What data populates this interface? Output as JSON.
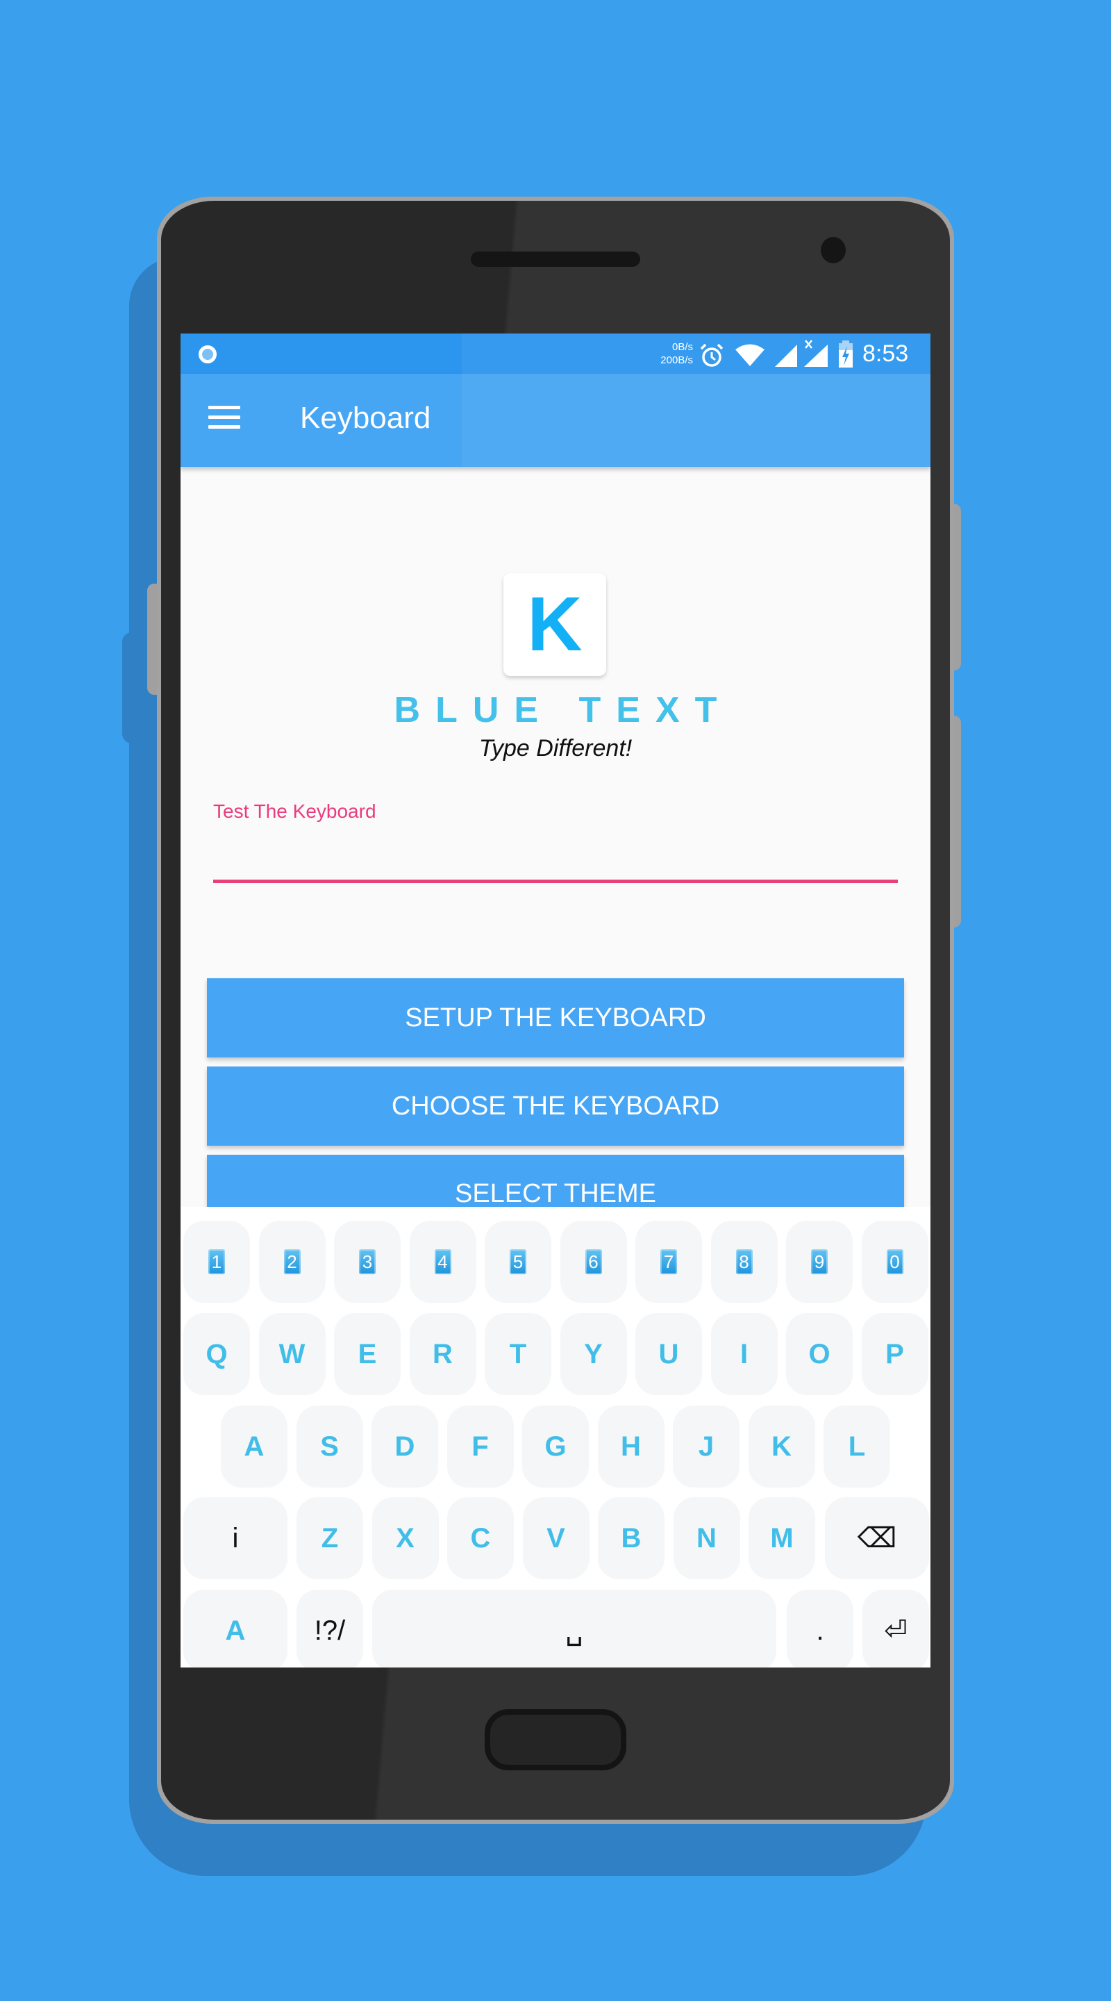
{
  "status_bar": {
    "net_down": "0B/s",
    "net_up": "200B/s",
    "icons": [
      "notification-ring-icon",
      "alarm-icon",
      "wifi-icon",
      "signal-icon",
      "signal-no-data-icon",
      "battery-charging-icon"
    ],
    "time": "8:53"
  },
  "app_bar": {
    "menu_icon": "hamburger-menu-icon",
    "title": "Keyboard"
  },
  "colors": {
    "app_bar": "#46a6f3",
    "status_bar": "#2c96ee",
    "brand_blue": "#43c1ea",
    "accent_pink": "#ea4079",
    "background": "#3a9fed"
  },
  "hero": {
    "logo_letter": "K",
    "brand_name": "BLUE TEXT",
    "tagline": "Type Different!"
  },
  "test_field": {
    "label": "Test The Keyboard",
    "value": "",
    "placeholder": ""
  },
  "buttons": {
    "setup": "SETUP THE KEYBOARD",
    "choose": "CHOOSE THE KEYBOARD",
    "theme": "SELECT THEME"
  },
  "keyboard": {
    "number_row": [
      "1",
      "2",
      "3",
      "4",
      "5",
      "6",
      "7",
      "8",
      "9",
      "0"
    ],
    "row1": [
      "Q",
      "W",
      "E",
      "R",
      "T",
      "Y",
      "U",
      "I",
      "O",
      "P"
    ],
    "row2": [
      "A",
      "S",
      "D",
      "F",
      "G",
      "H",
      "J",
      "K",
      "L"
    ],
    "row3": [
      "Z",
      "X",
      "C",
      "V",
      "B",
      "N",
      "M"
    ],
    "info_key": "i",
    "backspace": "⌫",
    "shift_key": "A",
    "symbols_key": "!?/",
    "space_key": "␣",
    "period_key": ".",
    "enter_key": "⏎"
  }
}
